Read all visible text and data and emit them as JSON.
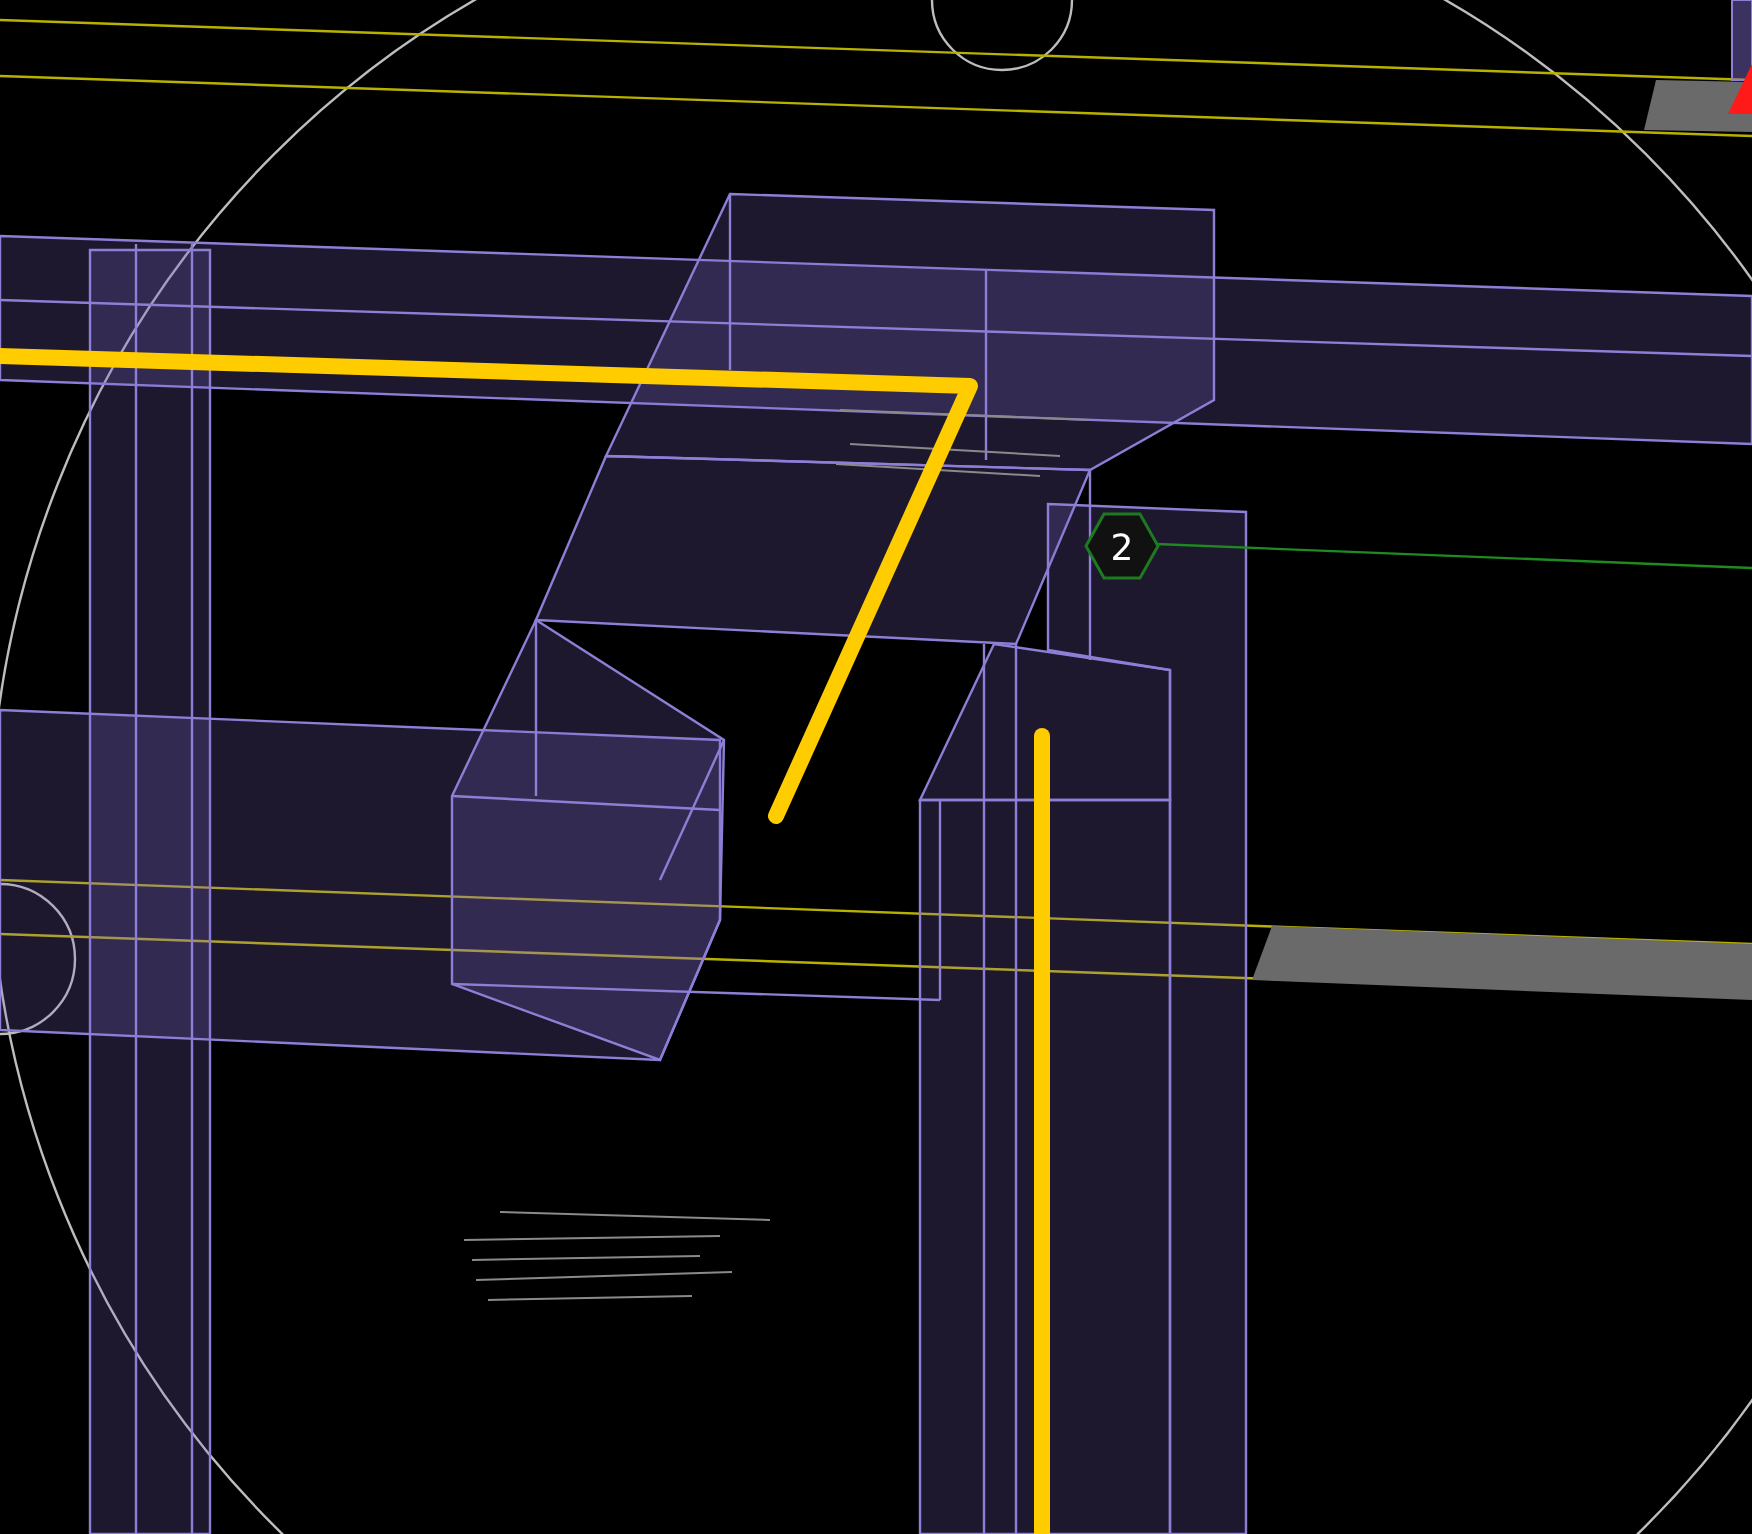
{
  "viewport": {
    "marker": {
      "label": "2"
    }
  }
}
